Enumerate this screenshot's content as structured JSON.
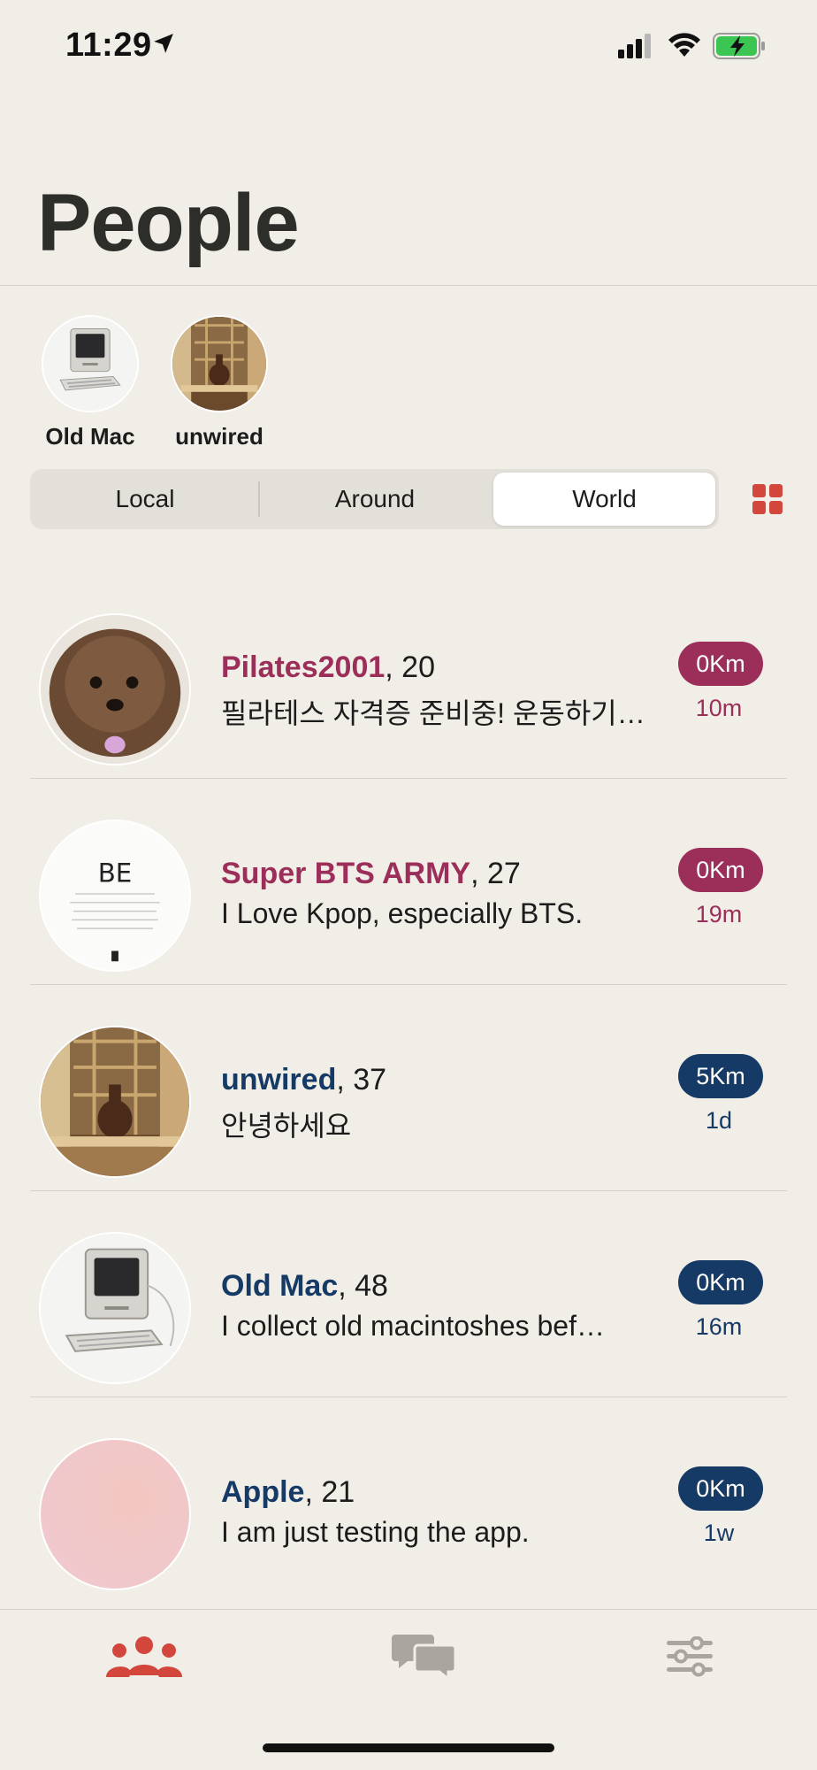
{
  "status_bar": {
    "time": "11:29"
  },
  "header": {
    "title": "People"
  },
  "favorites": [
    {
      "name": "Old Mac",
      "icon": "computer-avatar"
    },
    {
      "name": "unwired",
      "icon": "vase-avatar"
    }
  ],
  "segments": {
    "tabs": [
      "Local",
      "Around",
      "World"
    ],
    "selected": "World"
  },
  "people": [
    {
      "name": "Pilates2001",
      "age": ", 20",
      "status": "필라테스 자격증 준비중! 운동하기…",
      "distance": "0Km",
      "time": "10m",
      "accent": "#9c2e5a",
      "avatar": "dog-avatar"
    },
    {
      "name": "Super BTS ARMY",
      "age": ", 27",
      "status": "I Love Kpop, especially BTS.",
      "distance": "0Km",
      "time": "19m",
      "accent": "#9c2e5a",
      "avatar": "be-album-avatar",
      "avatar_text": "BE"
    },
    {
      "name": "unwired",
      "age": ", 37",
      "status": "안녕하세요",
      "distance": "5Km",
      "time": "1d",
      "accent": "#163a66",
      "avatar": "vase-avatar"
    },
    {
      "name": "Old Mac",
      "age": ", 48",
      "status": "I collect old macintoshes bef…",
      "distance": "0Km",
      "time": "16m",
      "accent": "#163a66",
      "avatar": "computer-avatar"
    },
    {
      "name": "Apple",
      "age": ", 21",
      "status": "I am just testing the app.",
      "distance": "0Km",
      "time": "1w",
      "accent": "#163a66",
      "avatar": "pink-avatar"
    }
  ],
  "tabbar": {
    "items": [
      {
        "icon": "people-icon",
        "active": true
      },
      {
        "icon": "chat-icon",
        "active": false
      },
      {
        "icon": "settings-sliders-icon",
        "active": false
      }
    ],
    "active_color": "#d2463c",
    "inactive_color": "#a9a6a0"
  }
}
